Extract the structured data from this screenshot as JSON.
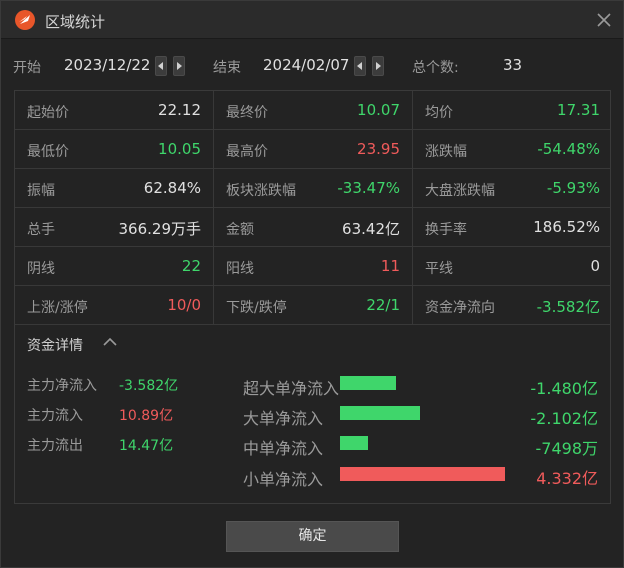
{
  "window": {
    "title": "区域统计"
  },
  "range": {
    "start_label": "开始",
    "start_value": "2023/12/22",
    "end_label": "结束",
    "end_value": "2024/02/07",
    "count_label": "总个数:",
    "count_value": "33"
  },
  "stats": [
    [
      {
        "label": "起始价",
        "value": "22.12",
        "color": "white"
      },
      {
        "label": "最终价",
        "value": "10.07",
        "color": "green"
      },
      {
        "label": "均价",
        "value": "17.31",
        "color": "green"
      }
    ],
    [
      {
        "label": "最低价",
        "value": "10.05",
        "color": "green"
      },
      {
        "label": "最高价",
        "value": "23.95",
        "color": "red"
      },
      {
        "label": "涨跌幅",
        "value": "-54.48%",
        "color": "green"
      }
    ],
    [
      {
        "label": "振幅",
        "value": "62.84%",
        "color": "white"
      },
      {
        "label": "板块涨跌幅",
        "value": "-33.47%",
        "color": "green"
      },
      {
        "label": "大盘涨跌幅",
        "value": "-5.93%",
        "color": "green"
      }
    ],
    [
      {
        "label": "总手",
        "value": "366.29万手",
        "color": "white"
      },
      {
        "label": "金额",
        "value": "63.42亿",
        "color": "white"
      },
      {
        "label": "换手率",
        "value": "186.52%",
        "color": "white"
      }
    ],
    [
      {
        "label": "阴线",
        "value": "22",
        "color": "green"
      },
      {
        "label": "阳线",
        "value": "11",
        "color": "red"
      },
      {
        "label": "平线",
        "value": "0",
        "color": "white"
      }
    ],
    [
      {
        "label": "上涨/涨停",
        "value": "10/0",
        "color": "red"
      },
      {
        "label": "下跌/跌停",
        "value": "22/1",
        "color": "green"
      },
      {
        "label": "资金净流向",
        "value": "-3.582亿",
        "color": "green"
      }
    ]
  ],
  "fund": {
    "title": "资金详情",
    "left": [
      {
        "label": "主力净流入",
        "value": "-3.582亿",
        "color": "green"
      },
      {
        "label": "主力流入",
        "value": "10.89亿",
        "color": "red"
      },
      {
        "label": "主力流出",
        "value": "14.47亿",
        "color": "green"
      }
    ],
    "right": [
      {
        "label": "超大单净流入",
        "value": "-1.480亿",
        "color": "green",
        "bar_color": "#3fd66b"
      },
      {
        "label": "大单净流入",
        "value": "-2.102亿",
        "color": "green",
        "bar_color": "#3fd66b"
      },
      {
        "label": "中单净流入",
        "value": "-7498万",
        "color": "green",
        "bar_color": "#3fd66b"
      },
      {
        "label": "小单净流入",
        "value": "4.332亿",
        "color": "red",
        "bar_color": "#f05b5b"
      }
    ]
  },
  "buttons": {
    "ok": "确定"
  }
}
